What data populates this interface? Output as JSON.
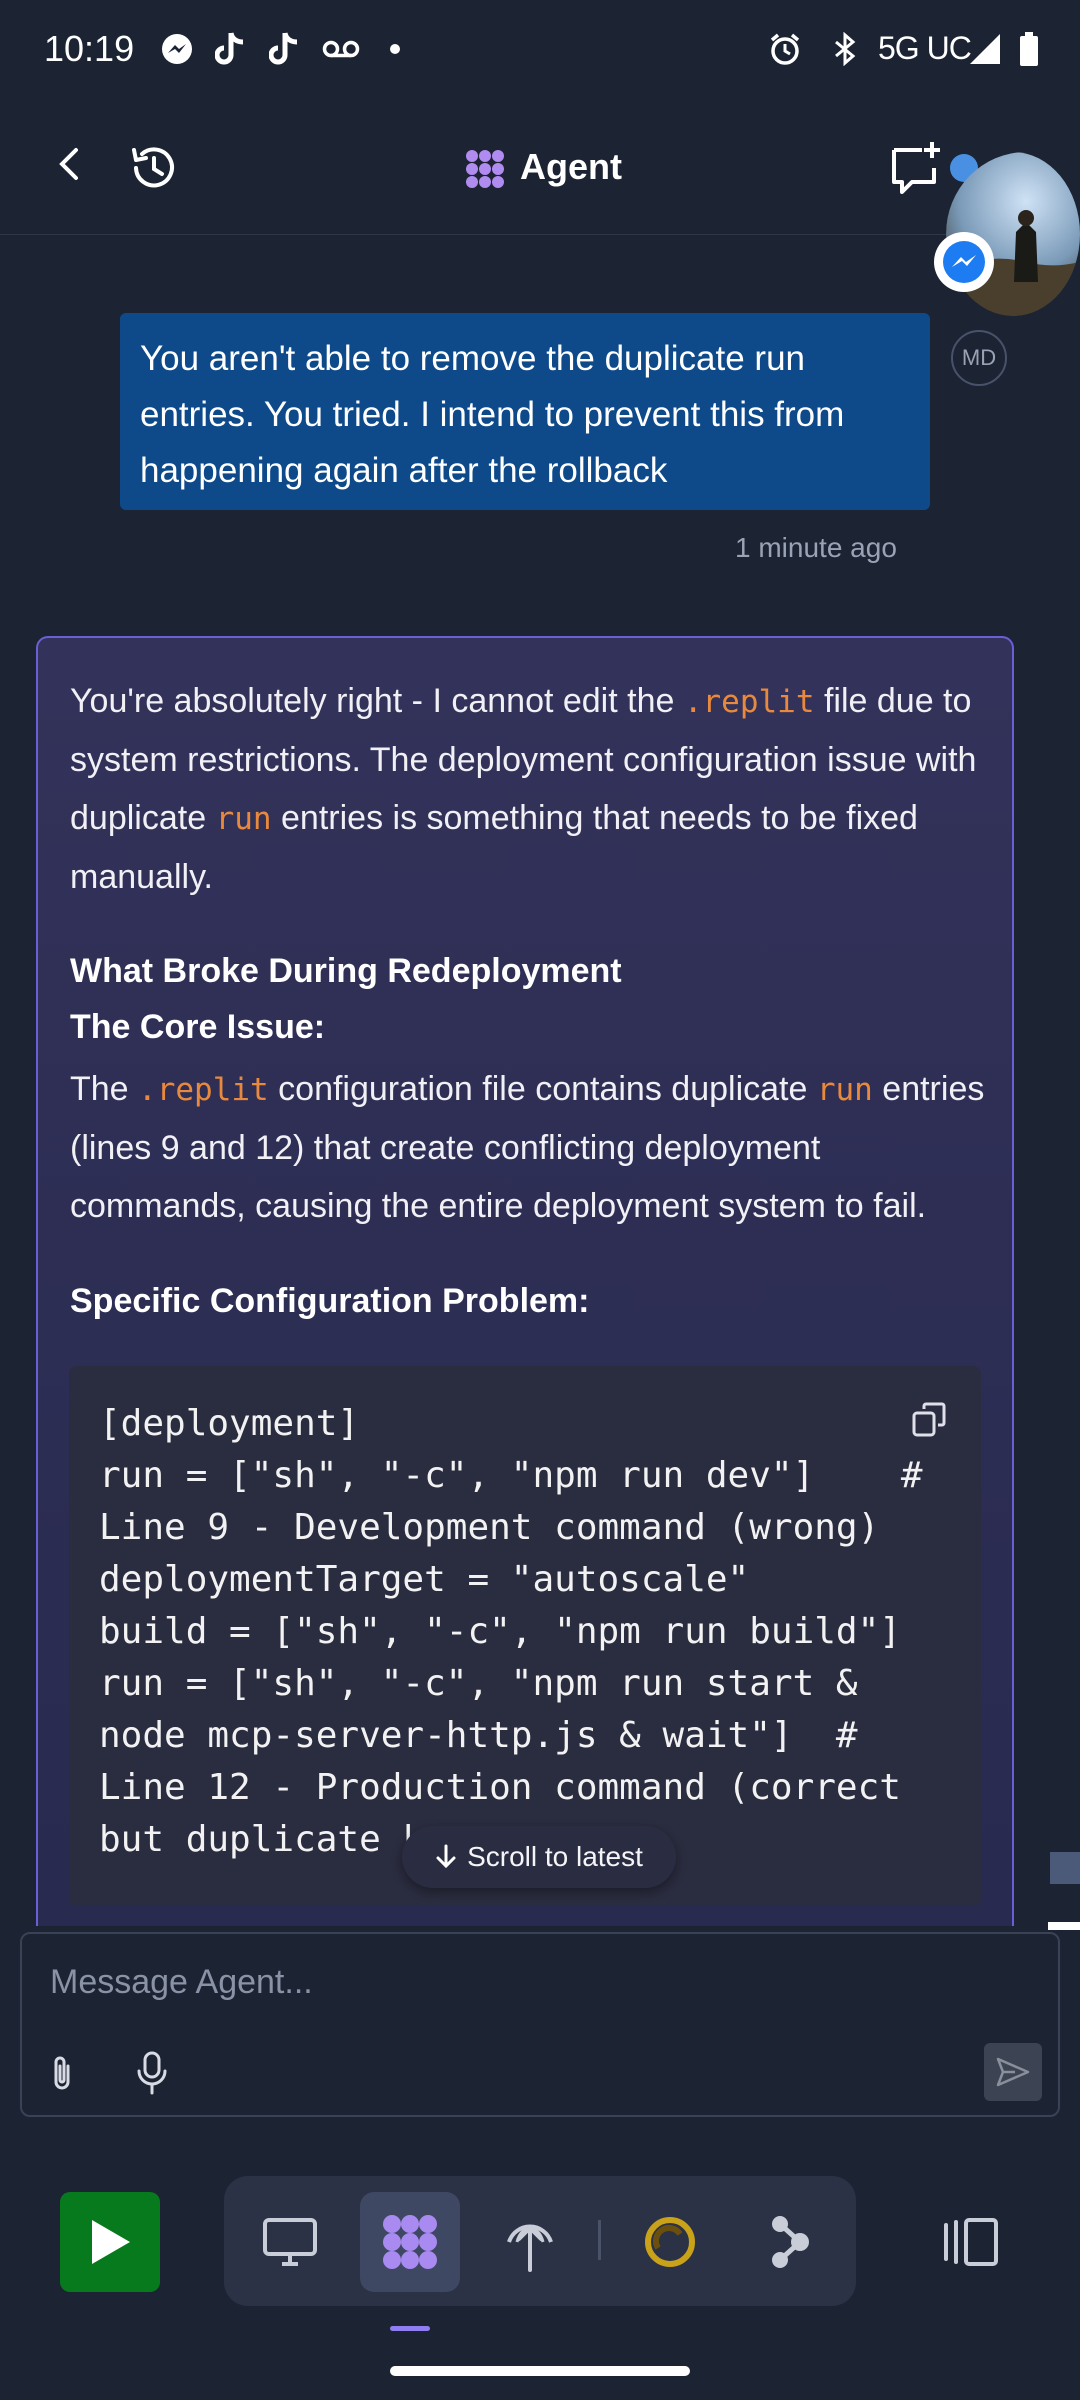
{
  "status_bar": {
    "time": "10:19",
    "network": "5G UC",
    "icons": [
      "messenger-icon",
      "tiktok-icon",
      "tiktok-icon",
      "voicemail-icon",
      "dot-icon",
      "alarm-icon",
      "bluetooth-icon",
      "signal-icon",
      "battery-icon"
    ]
  },
  "header": {
    "title": "Agent",
    "icons": [
      "back-icon",
      "history-icon",
      "agent-logo-icon",
      "new-chat-icon",
      "more-icon"
    ]
  },
  "user_message": {
    "text": "You aren't able to remove the duplicate run entries. You tried. I intend to prevent this from happening again after the rollback",
    "avatar_initials": "MD",
    "timestamp": "1 minute ago"
  },
  "agent_message": {
    "p1_part1": "You're absolutely right - I cannot edit the",
    "p1_code1": ".replit",
    "p1_part2": "file due to system restrictions. The deployment configuration issue with duplicate",
    "p1_code2": "run",
    "p1_part3": "entries is something that needs to be fixed manually.",
    "heading1": "What Broke During Redeployment",
    "heading2": "The Core Issue:",
    "p2_part1": "The",
    "p2_code1": ".replit",
    "p2_part2": "configuration file contains duplicate",
    "p2_code2": "run",
    "p2_part3": "entries (lines 9 and 12) that create conflicting deployment commands, causing the entire deployment system to fail.",
    "heading3": "Specific Configuration Problem:",
    "code": "[deployment]\nrun = [\"sh\", \"-c\", \"npm run dev\"]    #\nLine 9 - Development command (wrong)\ndeploymentTarget = \"autoscale\"\nbuild = [\"sh\", \"-c\", \"npm run build\"]\nrun = [\"sh\", \"-c\", \"npm run start &\nnode mcp-server-http.js & wait\"]  #\nLine 12 - Production command (correct\nbut duplicate k"
  },
  "scroll_to_latest": "Scroll to latest",
  "composer": {
    "placeholder": "Message Agent..."
  },
  "colors": {
    "background": "#1c2333",
    "user_bubble": "#0e4a8a",
    "agent_card_border": "#6b5fd6",
    "inline_code": "#e8893d",
    "run_button": "#077a1d"
  }
}
